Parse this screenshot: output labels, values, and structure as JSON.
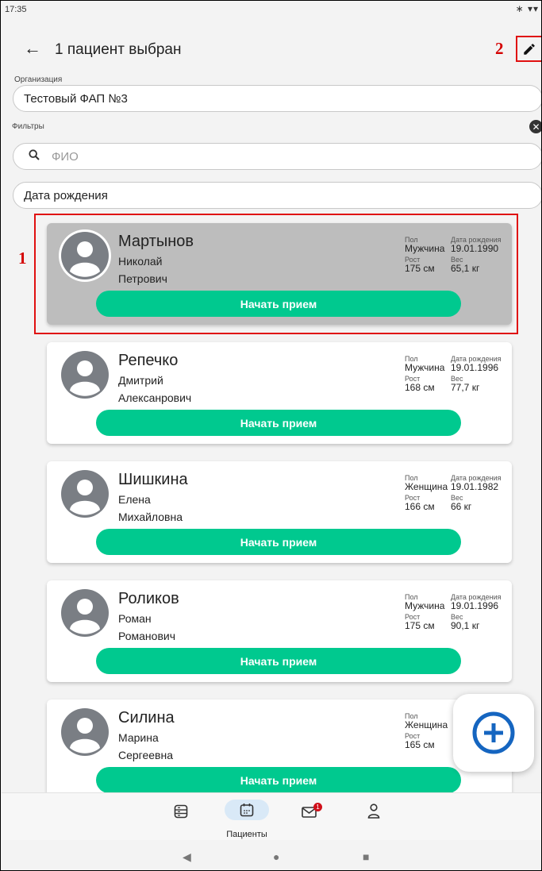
{
  "status_bar": {
    "time": "17:35",
    "icons": "∗ ▾▾"
  },
  "app_bar": {
    "title": "1 пациент выбран"
  },
  "annotations": {
    "edit_marker": "2",
    "selected_marker": "1"
  },
  "organization": {
    "label": "Организация",
    "value": "Тестовый ФАП №3"
  },
  "filters": {
    "label": "Фильтры",
    "name_placeholder": "ФИО",
    "birthdate_placeholder": "Дата рождения"
  },
  "labels": {
    "gender": "Пол",
    "birthdate": "Дата рождения",
    "height": "Рост",
    "weight": "Вес",
    "start_button": "Начать прием"
  },
  "patients": [
    {
      "surname": "Мартынов",
      "first_name": "Николай",
      "patronymic": "Петрович",
      "gender": "Мужчина",
      "birthdate": "19.01.1990",
      "height": "175 см",
      "weight": "65,1 кг",
      "selected": true
    },
    {
      "surname": "Репечко",
      "first_name": "Дмитрий",
      "patronymic": "Алексанрович",
      "gender": "Мужчина",
      "birthdate": "19.01.1996",
      "height": "168 см",
      "weight": "77,7 кг",
      "selected": false
    },
    {
      "surname": "Шишкина",
      "first_name": "Елена",
      "patronymic": "Михайловна",
      "gender": "Женщина",
      "birthdate": "19.01.1982",
      "height": "166 см",
      "weight": "66 кг",
      "selected": false
    },
    {
      "surname": "Роликов",
      "first_name": "Роман",
      "patronymic": "Романович",
      "gender": "Мужчина",
      "birthdate": "19.01.1996",
      "height": "175 см",
      "weight": "90,1 кг",
      "selected": false
    },
    {
      "surname": "Силина",
      "first_name": "Марина",
      "patronymic": "Сергеевна",
      "gender": "Женщина",
      "birthdate": "",
      "height": "165 см",
      "weight": "",
      "selected": false
    }
  ],
  "bottom_nav": {
    "active_label": "Пациенты",
    "messages_badge": "1",
    "icons": [
      "schedule-icon",
      "calendar-icon",
      "mail-icon",
      "profile-icon"
    ]
  },
  "colors": {
    "accent": "#00c98f",
    "fab_icon": "#1565c0",
    "selected_card": "#bdbdbd",
    "annotation": "#e01010"
  }
}
